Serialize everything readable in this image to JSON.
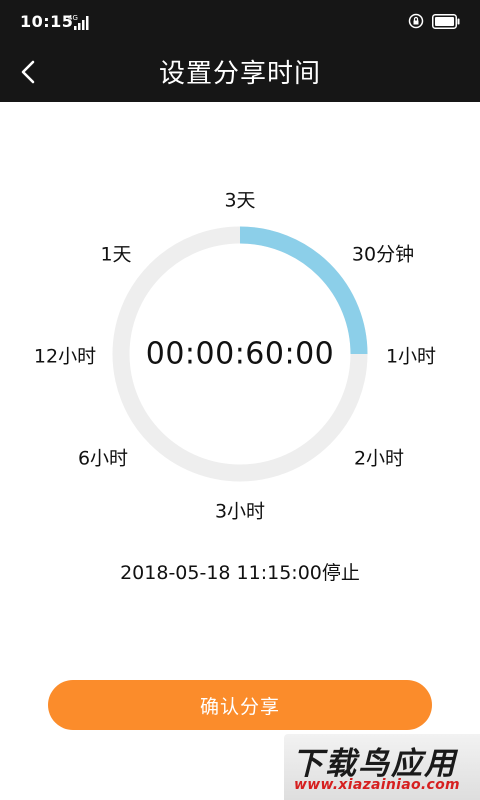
{
  "status_bar": {
    "time": "10:15",
    "network": "4G"
  },
  "header": {
    "title": "设置分享时间"
  },
  "dial": {
    "labels": [
      "3天",
      "30分钟",
      "1小时",
      "2小时",
      "3小时",
      "6小时",
      "12小时",
      "1天"
    ],
    "readout": "00:00:60:00",
    "selected_fraction": 0.25,
    "colors": {
      "track": "#eeeeee",
      "progress": "#8ccfe9"
    }
  },
  "stop_time": "2018-05-18 11:15:00停止",
  "confirm": {
    "label": "确认分享",
    "color": "#fb8c2b"
  },
  "watermark": {
    "title": "下载鸟应用",
    "url": "www.xiazainiao.com"
  }
}
